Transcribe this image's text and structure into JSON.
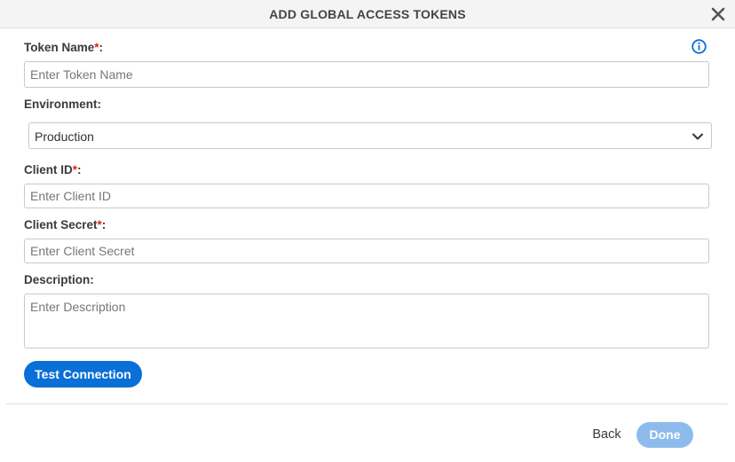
{
  "dialog": {
    "title": "ADD GLOBAL ACCESS TOKENS",
    "close_icon": "close-icon",
    "info_icon": "info-icon"
  },
  "form": {
    "token_name": {
      "label": "Token Name",
      "required_mark": "*",
      "suffix": ":",
      "placeholder": "Enter Token Name",
      "value": ""
    },
    "environment": {
      "label": "Environment:",
      "selected": "Production",
      "chevron_icon": "chevron-down-icon"
    },
    "client_id": {
      "label": "Client ID",
      "required_mark": "*",
      "suffix": ":",
      "placeholder": "Enter Client ID",
      "value": ""
    },
    "client_secret": {
      "label": "Client Secret",
      "required_mark": "*",
      "suffix": ":",
      "placeholder": "Enter Client Secret",
      "value": ""
    },
    "description": {
      "label": "Description:",
      "placeholder": "Enter Description",
      "value": ""
    },
    "test_connection_label": "Test Connection"
  },
  "footer": {
    "back_label": "Back",
    "done_label": "Done"
  },
  "colors": {
    "primary": "#0a6fd6",
    "primary_disabled": "#8dbcec",
    "required": "#e0201b",
    "header_bg": "#f4f4f4"
  }
}
